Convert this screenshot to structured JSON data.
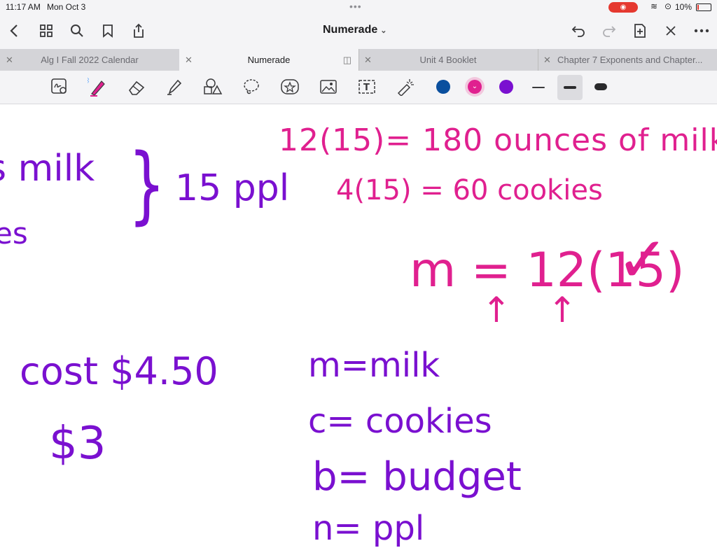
{
  "status": {
    "time": "11:17 AM",
    "date": "Mon Oct 3",
    "battery": "10%",
    "record_icon": "record-icon"
  },
  "nav": {
    "title": "Numerade"
  },
  "tabs": [
    {
      "label": "Alg I Fall 2022 Calendar"
    },
    {
      "label": "Numerade"
    },
    {
      "label": "Unit 4 Booklet"
    },
    {
      "label": "Chapter 7 Exponents and Chapter..."
    }
  ],
  "colors": {
    "blue": "#0a4f9e",
    "pink": "#e0208f",
    "purple": "#7a10d0"
  },
  "notes": {
    "l1": "s milk",
    "l2": "es",
    "bracket": "}",
    "ppl": "15 ppl",
    "r1": "12(15)= 180 ounces of milk",
    "r2": "4(15) = 60 cookies",
    "eq": "m = 12(15)",
    "check": "✓",
    "arrow1": "↑",
    "arrow2": "↑",
    "cost": "cost $4.50",
    "three": "$3",
    "v1": "m=milk",
    "v2": "c= cookies",
    "v3": "b= budget",
    "v4": "n= ppl"
  }
}
